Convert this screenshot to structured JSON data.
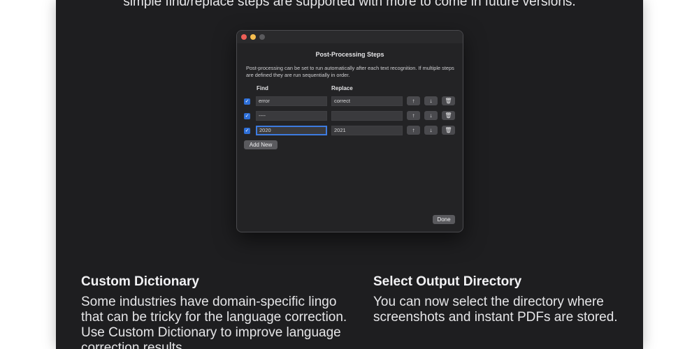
{
  "intro_line": "simple find/replace steps are supported with more to come in future versions.",
  "dialog": {
    "title": "Post-Processing Steps",
    "description": "Post-processing can be set to run automatically after each text recognition. If multiple steps are defined they are run sequentially in order.",
    "columns": {
      "find": "Find",
      "replace": "Replace"
    },
    "rows": [
      {
        "checked": true,
        "find": "error",
        "replace": "correct",
        "focused": false
      },
      {
        "checked": true,
        "find": "----",
        "replace": "",
        "focused": false
      },
      {
        "checked": true,
        "find": "2020",
        "replace": "2021",
        "focused": true
      }
    ],
    "row_icons": {
      "check": "✓",
      "up": "↑",
      "down": "↓",
      "delete": "🗑"
    },
    "add_label": "Add New",
    "done_label": "Done"
  },
  "sections": {
    "custom_dictionary": {
      "title": "Custom Dictionary",
      "body": "Some industries have domain-specific lingo that can be tricky for the language correction. Use Custom Dictionary to improve language correction results."
    },
    "output_directory": {
      "title": "Select Output Directory",
      "body": "You can now select the directory where screenshots and instant PDFs are stored."
    }
  }
}
